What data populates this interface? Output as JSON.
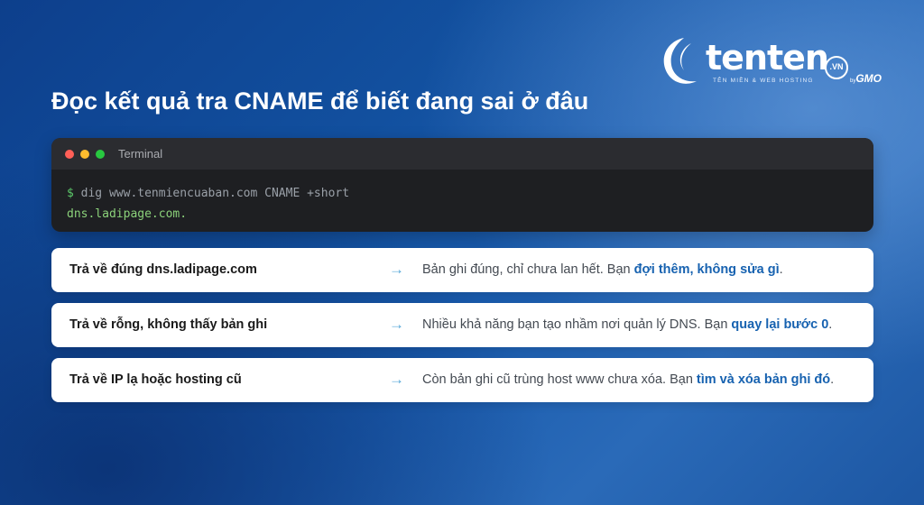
{
  "brand": {
    "name": "tenten",
    "domain_badge": ".VN",
    "tagline": "TÊN MIỀN & WEB HOSTING",
    "by": "by",
    "parent": "GMO"
  },
  "heading": "Đọc kết quả tra CNAME để biết đang sai ở đâu",
  "terminal": {
    "title": "Terminal",
    "prompt": "$",
    "command": "dig www.tenmiencuaban.com CNAME +short",
    "output": "dns.ladipage.com."
  },
  "rows": [
    {
      "label": "Trả về đúng dns.ladipage.com",
      "arrow": "→",
      "desc": "Bản ghi đúng, chỉ chưa lan hết. Bạn ",
      "highlight": "đợi thêm, không sửa gì",
      "end": "."
    },
    {
      "label": "Trả về rỗng, không thấy bản ghi",
      "arrow": "→",
      "desc": "Nhiều khả năng bạn tạo nhầm nơi quản lý DNS. Bạn ",
      "highlight": "quay lại bước 0",
      "end": "."
    },
    {
      "label": "Trả về IP lạ hoặc hosting cũ",
      "arrow": "→",
      "desc": "Còn bản ghi cũ trùng host www chưa xóa. Bạn ",
      "highlight": "tìm và xóa bản ghi đó",
      "end": "."
    }
  ],
  "colors": {
    "background": "#1a5cae",
    "terminal_bg": "#1e1f22",
    "prompt_green": "#5cc96a",
    "output_green": "#8bd17a",
    "highlight_blue": "#1762b0",
    "arrow_blue": "#5aaad8"
  },
  "icons": {
    "window_controls": [
      "close-dot",
      "minimize-dot",
      "maximize-dot"
    ],
    "logo_mark": "swoosh-logo-icon",
    "row_arrow": "right-arrow-icon"
  }
}
